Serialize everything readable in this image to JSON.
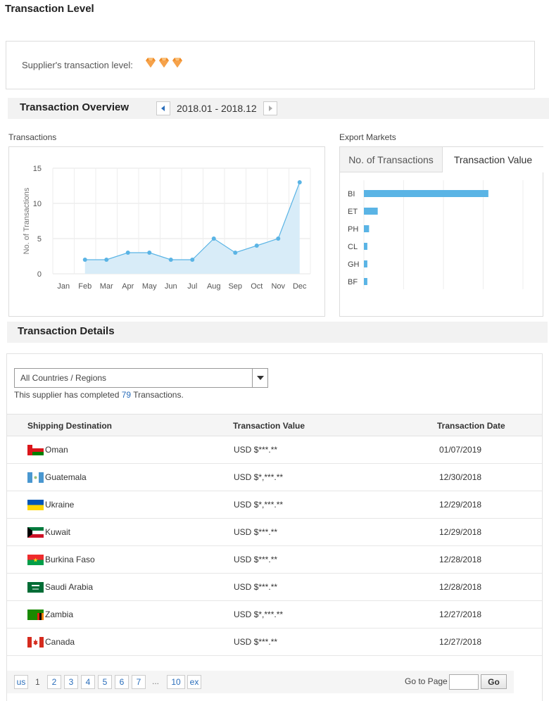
{
  "page_title": "Transaction Level",
  "level": {
    "label": "Supplier's transaction level:",
    "icon": "diamond-icon",
    "diamond_count": 3,
    "diamond_color": "#f08a24"
  },
  "overview": {
    "title": "Transaction Overview",
    "range": "2018.01 - 2018.12",
    "transactions_label": "Transactions",
    "export_markets_label": "Export Markets"
  },
  "chart_data": [
    {
      "type": "area",
      "title": "",
      "xlabel": "",
      "ylabel": "No. of Transactions",
      "ylim": [
        0,
        15
      ],
      "yticks": [
        "0",
        "5",
        "10",
        "15"
      ],
      "categories": [
        "Jan",
        "Feb",
        "Mar",
        "Apr",
        "May",
        "Jun",
        "Jul",
        "Aug",
        "Sep",
        "Oct",
        "Nov",
        "Dec"
      ],
      "values": [
        null,
        2,
        2,
        3,
        3,
        2,
        2,
        5,
        3,
        4,
        5,
        13
      ],
      "color": "#5ab4e5",
      "fill": "#d8ecf8",
      "grid": true
    },
    {
      "type": "bar",
      "orientation": "horizontal",
      "categories": [
        "BI",
        "ET",
        "PH",
        "CL",
        "GH",
        "BF"
      ],
      "values": [
        36,
        4,
        1.5,
        1,
        1,
        1
      ],
      "xlim": [
        0,
        46
      ],
      "color": "#5ab4e5",
      "grid": true
    }
  ],
  "markets_tabs": {
    "count_label": "No. of Transactions",
    "value_label": "Transaction Value"
  },
  "details": {
    "title": "Transaction Details",
    "select_value": "All Countries / Regions",
    "completed_prefix": "This supplier has completed ",
    "completed_count": "79",
    "completed_suffix": " Transactions.",
    "columns": [
      "Shipping Destination",
      "Transaction Value",
      "Transaction Date"
    ],
    "rows": [
      {
        "country": "Oman",
        "value": "USD $***.**",
        "date": "01/07/2019",
        "flag": "oman-flag-icon"
      },
      {
        "country": "Guatemala",
        "value": "USD $*,***.**",
        "date": "12/30/2018",
        "flag": "guatemala-flag-icon"
      },
      {
        "country": "Ukraine",
        "value": "USD $*,***.**",
        "date": "12/29/2018",
        "flag": "ukraine-flag-icon"
      },
      {
        "country": "Kuwait",
        "value": "USD $***.**",
        "date": "12/29/2018",
        "flag": "kuwait-flag-icon"
      },
      {
        "country": "Burkina Faso",
        "value": "USD $***.**",
        "date": "12/28/2018",
        "flag": "burkina-faso-flag-icon"
      },
      {
        "country": "Saudi Arabia",
        "value": "USD $***.**",
        "date": "12/28/2018",
        "flag": "saudi-arabia-flag-icon"
      },
      {
        "country": "Zambia",
        "value": "USD $*,***.**",
        "date": "12/27/2018",
        "flag": "zambia-flag-icon"
      },
      {
        "country": "Canada",
        "value": "USD $***.**",
        "date": "12/27/2018",
        "flag": "canada-flag-icon"
      }
    ]
  },
  "pagination": {
    "prev_label": "us",
    "current": "1",
    "pages": [
      "2",
      "3",
      "4",
      "5",
      "6",
      "7"
    ],
    "ellipsis": "...",
    "last": "10",
    "next_label": "ex",
    "goto_label": "Go to Page",
    "go_label": "Go"
  }
}
